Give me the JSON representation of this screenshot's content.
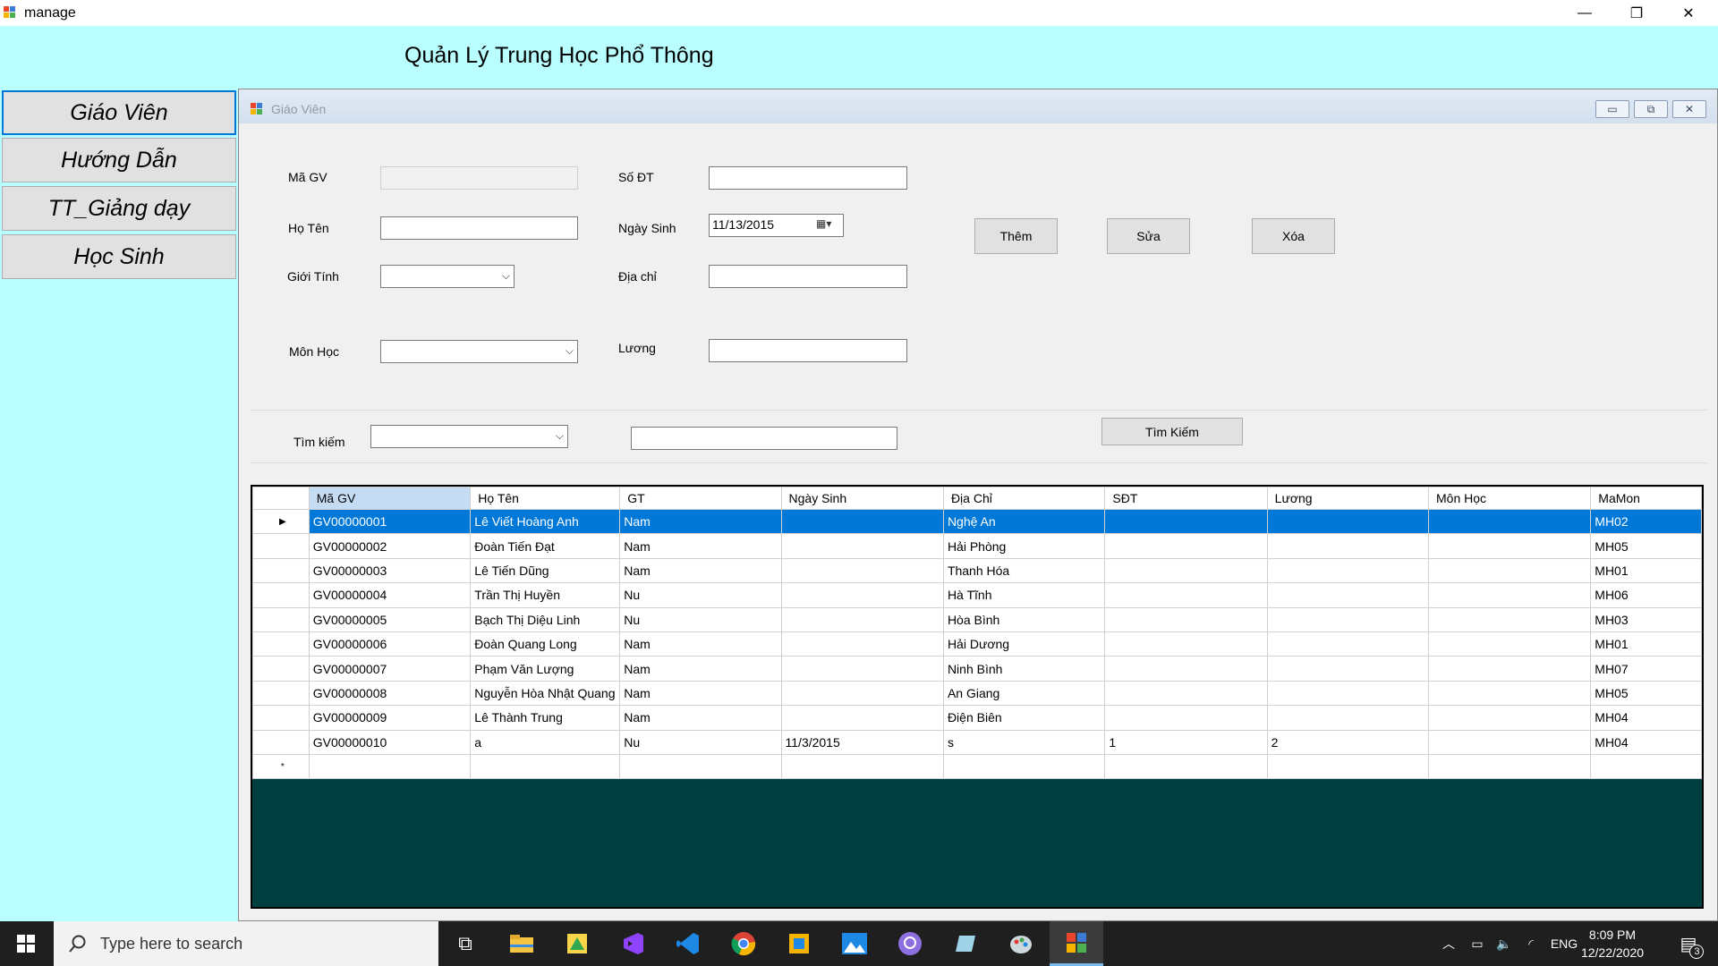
{
  "window": {
    "title": "manage",
    "minimize": "—",
    "restore": "❐",
    "close": "✕"
  },
  "heading": "Quản Lý Trung Học Phổ Thông",
  "nav": [
    {
      "label": "Giáo Viên"
    },
    {
      "label": "Hướng Dẫn"
    },
    {
      "label": "TT_Giảng dạy"
    },
    {
      "label": "Học Sinh"
    }
  ],
  "child": {
    "title": "Giáo Viên",
    "minimize": "▭",
    "restore": "⧉",
    "close": "✕"
  },
  "form": {
    "magv_label": "Mã GV",
    "hoten_label": "Họ Tên",
    "gioitinh_label": "Giới Tính",
    "monhoc_label": "Môn Học",
    "sodt_label": "Số ĐT",
    "ngaysinh_label": "Ngày Sinh",
    "ngaysinh_value": "11/13/2015",
    "diachi_label": "Địa chỉ",
    "luong_label": "Lương",
    "them_label": "Thêm",
    "sua_label": "Sửa",
    "xoa_label": "Xóa",
    "timkiem_label": "Tìm kiếm",
    "timkiem_button": "Tìm Kiếm"
  },
  "grid": {
    "columns": [
      "Mã GV",
      "Họ Tên",
      "GT",
      "Ngày Sinh",
      "Địa Chỉ",
      "SĐT",
      "Lương",
      "Môn Học",
      "MaMon"
    ],
    "rows": [
      [
        "GV00000001",
        "Lê Viết Hoàng Anh",
        "Nam",
        "",
        "Nghệ An",
        "",
        "",
        "",
        "MH02"
      ],
      [
        "GV00000002",
        "Đoàn Tiến Đạt",
        "Nam",
        "",
        "Hải Phòng",
        "",
        "",
        "",
        "MH05"
      ],
      [
        "GV00000003",
        "Lê Tiến Dũng",
        "Nam",
        "",
        "Thanh Hóa",
        "",
        "",
        "",
        "MH01"
      ],
      [
        "GV00000004",
        "Trần Thị Huyền",
        "Nu",
        "",
        "Hà Tĩnh",
        "",
        "",
        "",
        "MH06"
      ],
      [
        "GV00000005",
        "Bạch Thị Diệu Linh",
        "Nu",
        "",
        "Hòa Bình",
        "",
        "",
        "",
        "MH03"
      ],
      [
        "GV00000006",
        "Đoàn Quang Long",
        "Nam",
        "",
        "Hải Dương",
        "",
        "",
        "",
        "MH01"
      ],
      [
        "GV00000007",
        "Phạm Văn Lượng",
        "Nam",
        "",
        "Ninh Bình",
        "",
        "",
        "",
        "MH07"
      ],
      [
        "GV00000008",
        "Nguyễn Hòa Nhật Quang",
        "Nam",
        "",
        "An Giang",
        "",
        "",
        "",
        "MH05"
      ],
      [
        "GV00000009",
        "Lê Thành Trung",
        "Nam",
        "",
        "Điện Biên",
        "",
        "",
        "",
        "MH04"
      ],
      [
        "GV00000010",
        "a",
        "Nu",
        "11/3/2015",
        "s",
        "1",
        "2",
        "",
        "MH04"
      ]
    ],
    "current_row_marker": "▶",
    "new_row_marker": "*"
  },
  "taskbar": {
    "search_placeholder": "Type here to search",
    "language": "ENG",
    "time": "8:09 PM",
    "date": "12/22/2020",
    "notification_count": "3"
  }
}
